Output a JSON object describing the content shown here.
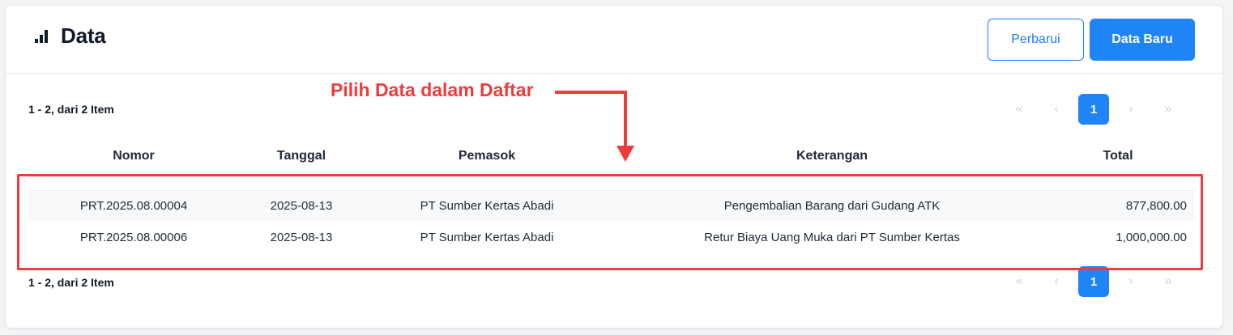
{
  "header": {
    "title": "Data",
    "refresh_label": "Perbarui",
    "new_label": "Data Baru"
  },
  "pagination": {
    "summary": "1 - 2, dari 2 Item",
    "first": "«",
    "prev": "‹",
    "current": "1",
    "next": "›",
    "last": "»"
  },
  "table": {
    "columns": [
      "Nomor",
      "Tanggal",
      "Pemasok",
      "Keterangan",
      "Total"
    ],
    "rows": [
      [
        "PRT.2025.08.00004",
        "2025-08-13",
        "PT Sumber Kertas Abadi",
        "Pengembalian Barang dari Gudang ATK",
        "877,800.00"
      ],
      [
        "PRT.2025.08.00006",
        "2025-08-13",
        "PT Sumber Kertas Abadi",
        "Retur Biaya Uang Muka dari PT Sumber Kertas",
        "1,000,000.00"
      ]
    ]
  },
  "annotation": {
    "text": "Pilih Data dalam Daftar",
    "color": "#ef3b3b"
  },
  "colors": {
    "primary": "#1f84f5",
    "annotation": "#ef3b3b"
  }
}
